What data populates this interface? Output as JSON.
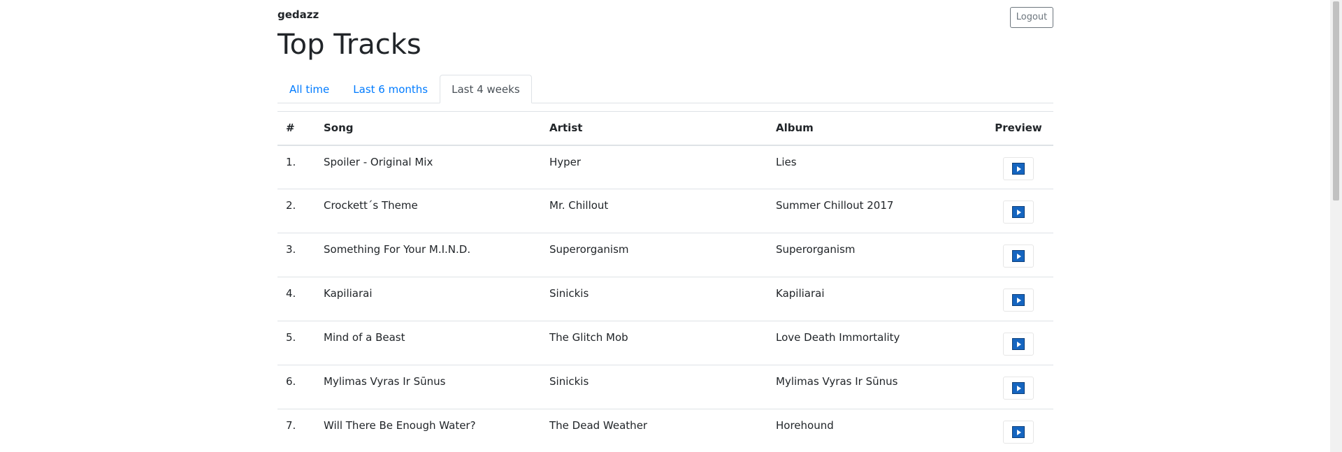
{
  "header": {
    "username": "gedazz",
    "logout_label": "Logout",
    "title": "Top Tracks"
  },
  "tabs": [
    {
      "label": "All time",
      "active": false
    },
    {
      "label": "Last 6 months",
      "active": false
    },
    {
      "label": "Last 4 weeks",
      "active": true
    }
  ],
  "table": {
    "headers": {
      "rank": "#",
      "song": "Song",
      "artist": "Artist",
      "album": "Album",
      "preview": "Preview"
    },
    "rows": [
      {
        "rank": "1.",
        "song": "Spoiler - Original Mix",
        "artist": "Hyper",
        "album": "Lies"
      },
      {
        "rank": "2.",
        "song": "Crockett´s Theme",
        "artist": "Mr. Chillout",
        "album": "Summer Chillout 2017"
      },
      {
        "rank": "3.",
        "song": "Something For Your M.I.N.D.",
        "artist": "Superorganism",
        "album": "Superorganism"
      },
      {
        "rank": "4.",
        "song": "Kapiliarai",
        "artist": "Sinickis",
        "album": "Kapiliarai"
      },
      {
        "rank": "5.",
        "song": "Mind of a Beast",
        "artist": "The Glitch Mob",
        "album": "Love Death Immortality"
      },
      {
        "rank": "6.",
        "song": "Mylimas Vyras Ir Sūnus",
        "artist": "Sinickis",
        "album": "Mylimas Vyras Ir Sūnus"
      },
      {
        "rank": "7.",
        "song": "Will There Be Enough Water?",
        "artist": "The Dead Weather",
        "album": "Horehound"
      }
    ],
    "preview_icon": "play-icon"
  },
  "colors": {
    "link": "#007bff",
    "active_tab_text": "#495057",
    "play_icon": "#1565c0"
  }
}
